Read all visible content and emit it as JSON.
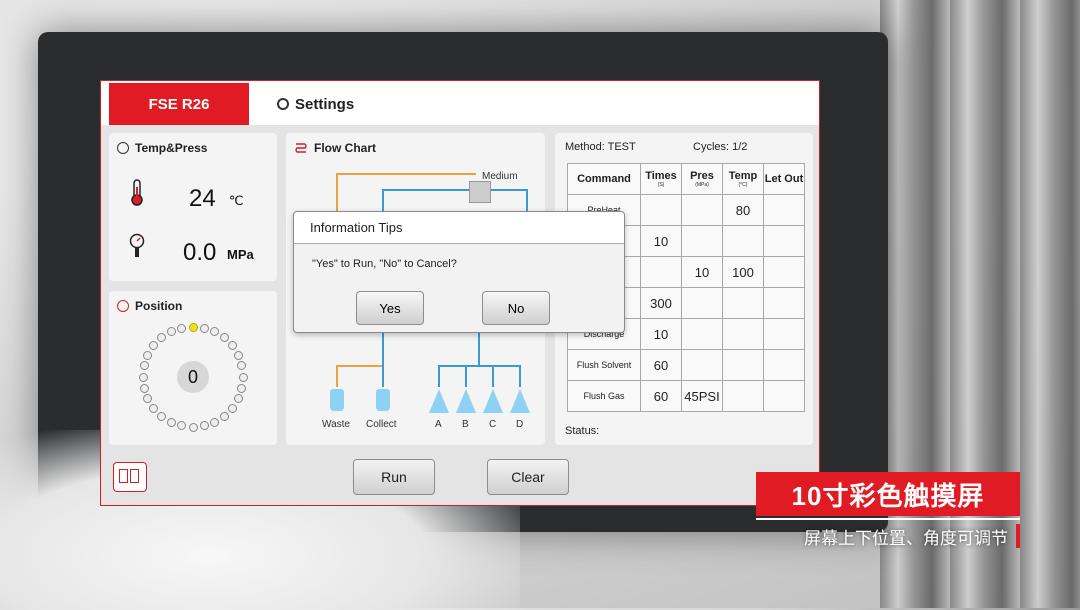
{
  "header": {
    "brand": "FSE R26",
    "settings_label": "Settings"
  },
  "temp_press": {
    "title": "Temp&Press",
    "temp_value": "24",
    "temp_unit": "℃",
    "press_value": "0.0",
    "press_unit": "MPa"
  },
  "position": {
    "title": "Position",
    "value": "0"
  },
  "flow_chart": {
    "title": "Flow Chart",
    "medium_label": "Medium",
    "outputs": [
      "Waste",
      "Collect",
      "A",
      "B",
      "C",
      "D"
    ]
  },
  "method_table": {
    "method_label": "Method: TEST",
    "cycles_label": "Cycles:  1/2",
    "columns": [
      {
        "label": "Command",
        "unit": ""
      },
      {
        "label": "Times",
        "unit": "(S)"
      },
      {
        "label": "Pres",
        "unit": "(MPa)"
      },
      {
        "label": "Temp",
        "unit": "(°C)"
      },
      {
        "label": "Let Out",
        "unit": ""
      }
    ],
    "rows": [
      {
        "command": "PreHeat",
        "times": "",
        "pres": "",
        "temp": "80",
        "let_out": ""
      },
      {
        "command": "",
        "times": "10",
        "pres": "",
        "temp": "",
        "let_out": ""
      },
      {
        "command": "",
        "times": "",
        "pres": "10",
        "temp": "100",
        "let_out": ""
      },
      {
        "command": "",
        "times": "300",
        "pres": "",
        "temp": "",
        "let_out": ""
      },
      {
        "command": "Discharge",
        "times": "10",
        "pres": "",
        "temp": "",
        "let_out": ""
      },
      {
        "command": "Flush Solvent",
        "times": "60",
        "pres": "",
        "temp": "",
        "let_out": ""
      },
      {
        "command": "Flush Gas",
        "times": "60",
        "pres": "45PSI",
        "temp": "",
        "let_out": ""
      }
    ],
    "status_label": "Status:"
  },
  "buttons": {
    "run": "Run",
    "clear": "Clear"
  },
  "dialog": {
    "title": "Information Tips",
    "message": "\"Yes\" to Run, \"No\" to Cancel?",
    "yes": "Yes",
    "no": "No"
  },
  "caption": {
    "headline": "10寸彩色触摸屏",
    "subline": "屏幕上下位置、角度可调节"
  },
  "colors": {
    "accent": "#e01b23",
    "flow_blue": "#3a9ad9",
    "flow_orange": "#f0a040",
    "vial_blue": "#8fd0f5"
  },
  "icons": {
    "gear": "gear-icon",
    "thermometer": "thermometer-icon",
    "gauge": "pressure-gauge-icon",
    "position": "position-icon",
    "flow": "flow-icon",
    "menu": "menu-icon"
  }
}
